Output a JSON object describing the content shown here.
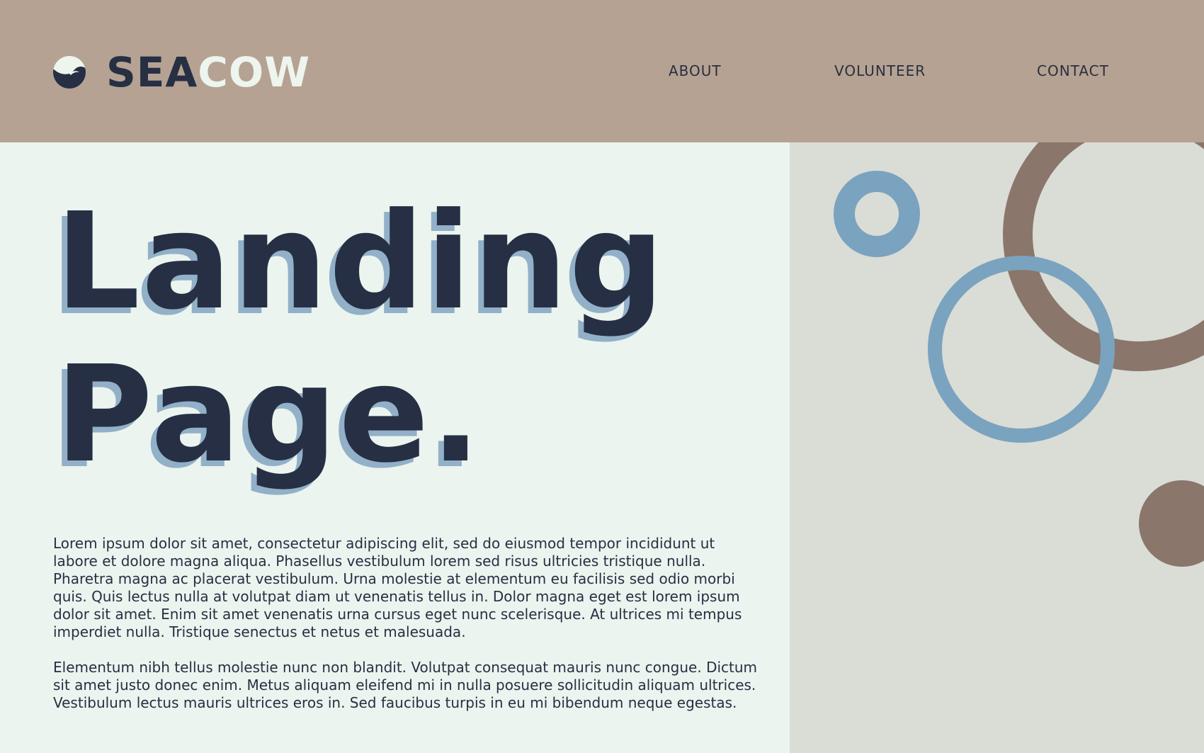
{
  "brand": {
    "name_part1": "SEA",
    "name_part2": "COW",
    "logo_icon": "wave-circle-icon"
  },
  "nav": {
    "items": [
      {
        "label": "ABOUT"
      },
      {
        "label": "VOLUNTEER"
      },
      {
        "label": "CONTACT"
      }
    ]
  },
  "hero": {
    "line1": "Landing",
    "line2": "Page."
  },
  "body": {
    "paragraphs": [
      "Lorem ipsum dolor sit amet, consectetur adipiscing elit, sed do eiusmod tempor incididunt ut labore et dolore magna aliqua. Phasellus vestibulum lorem sed risus ultricies tristique nulla. Pharetra magna ac placerat vestibulum. Urna molestie at elementum eu facilisis sed odio morbi quis. Quis lectus nulla at volutpat diam ut venenatis tellus in. Dolor magna eget est lorem ipsum dolor sit amet. Enim sit amet venenatis urna cursus eget nunc scelerisque. At ultrices mi tempus imperdiet nulla. Tristique senectus et netus et malesuada.",
      "Elementum nibh tellus molestie nunc non blandit. Volutpat consequat mauris nunc congue. Dictum sit amet justo donec enim. Metus aliquam eleifend mi in nulla posuere sollicitudin aliquam ultrices. Vestibulum lectus mauris ultrices eros in. Sed faucibus turpis in eu mi bibendum neque egestas."
    ]
  },
  "colors": {
    "header_bg": "#b5a293",
    "navy": "#262f43",
    "cream": "#eef4ee",
    "left_bg": "#ebf4ee",
    "right_bg": "#dadcd6",
    "blue_ring": "#7aa3bf",
    "brown_ring": "#8a766b",
    "title_shadow": "#92b0c8"
  }
}
